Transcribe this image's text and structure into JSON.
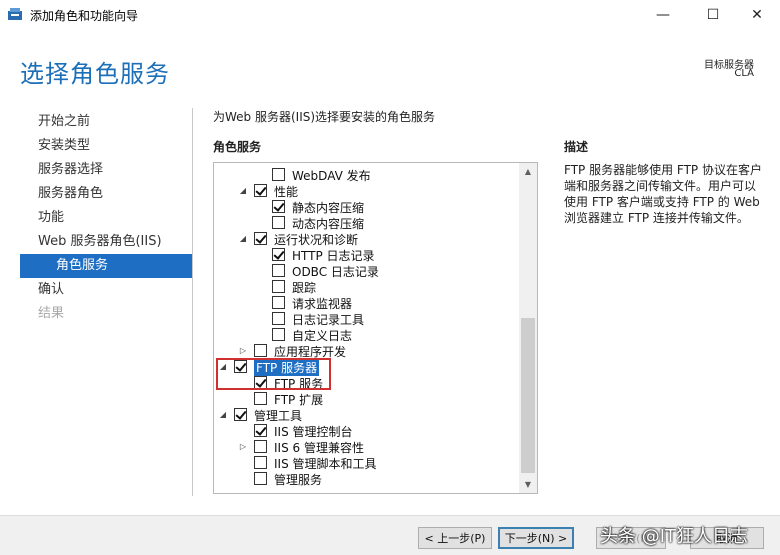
{
  "window": {
    "title": "添加角色和功能向导",
    "min_glyph": "—",
    "max_glyph": "☐",
    "close_glyph": "✕"
  },
  "header": {
    "page_title": "选择角色服务",
    "target_label": "目标服务器",
    "target_value": "CLA"
  },
  "nav": {
    "items": [
      {
        "label": "开始之前",
        "state": "normal"
      },
      {
        "label": "安装类型",
        "state": "normal"
      },
      {
        "label": "服务器选择",
        "state": "normal"
      },
      {
        "label": "服务器角色",
        "state": "normal"
      },
      {
        "label": "功能",
        "state": "normal"
      },
      {
        "label": "Web 服务器角色(IIS)",
        "state": "normal"
      },
      {
        "label": "角色服务",
        "state": "active"
      },
      {
        "label": "确认",
        "state": "normal"
      },
      {
        "label": "结果",
        "state": "disabled"
      }
    ]
  },
  "main": {
    "instruction": "为Web 服务器(IIS)选择要安装的角色服务",
    "roles_header": "角色服务",
    "desc_header": "描述",
    "description": "FTP 服务器能够使用 FTP 协议在客户端和服务器之间传输文件。用户可以使用 FTP 客户端或支持 FTP 的 Web 浏览器建立 FTP 连接并传输文件。"
  },
  "tree": [
    {
      "label": "WebDAV 发布",
      "level": 2,
      "checked": false,
      "expander": "none"
    },
    {
      "label": "性能",
      "level": 1,
      "checked": true,
      "expander": "expanded"
    },
    {
      "label": "静态内容压缩",
      "level": 2,
      "checked": true,
      "expander": "none"
    },
    {
      "label": "动态内容压缩",
      "level": 2,
      "checked": false,
      "expander": "none"
    },
    {
      "label": "运行状况和诊断",
      "level": 1,
      "checked": true,
      "expander": "expanded"
    },
    {
      "label": "HTTP 日志记录",
      "level": 2,
      "checked": true,
      "expander": "none"
    },
    {
      "label": "ODBC 日志记录",
      "level": 2,
      "checked": false,
      "expander": "none"
    },
    {
      "label": "跟踪",
      "level": 2,
      "checked": false,
      "expander": "none"
    },
    {
      "label": "请求监视器",
      "level": 2,
      "checked": false,
      "expander": "none"
    },
    {
      "label": "日志记录工具",
      "level": 2,
      "checked": false,
      "expander": "none"
    },
    {
      "label": "自定义日志",
      "level": 2,
      "checked": false,
      "expander": "none"
    },
    {
      "label": "应用程序开发",
      "level": 1,
      "checked": false,
      "expander": "collapsed"
    },
    {
      "label": "FTP 服务器",
      "level": 0,
      "checked": true,
      "expander": "expanded",
      "selected": true
    },
    {
      "label": "FTP 服务",
      "level": 1,
      "checked": true,
      "expander": "none"
    },
    {
      "label": "FTP 扩展",
      "level": 1,
      "checked": false,
      "expander": "none"
    },
    {
      "label": "管理工具",
      "level": 0,
      "checked": true,
      "expander": "expanded"
    },
    {
      "label": "IIS 管理控制台",
      "level": 1,
      "checked": true,
      "expander": "none"
    },
    {
      "label": "IIS 6 管理兼容性",
      "level": 1,
      "checked": false,
      "expander": "collapsed"
    },
    {
      "label": "IIS 管理脚本和工具",
      "level": 1,
      "checked": false,
      "expander": "none"
    },
    {
      "label": "管理服务",
      "level": 1,
      "checked": false,
      "expander": "none"
    }
  ],
  "footer": {
    "prev_label": "< 上一步(P)",
    "next_label": "下一步(N) >",
    "install_label": "安装(I)",
    "cancel_label": "取消"
  },
  "watermark": "头条 @IT狂人日志",
  "colors": {
    "accent": "#1e6ec4",
    "title_blue": "#1d6fb8",
    "highlight_red": "#d03030"
  }
}
